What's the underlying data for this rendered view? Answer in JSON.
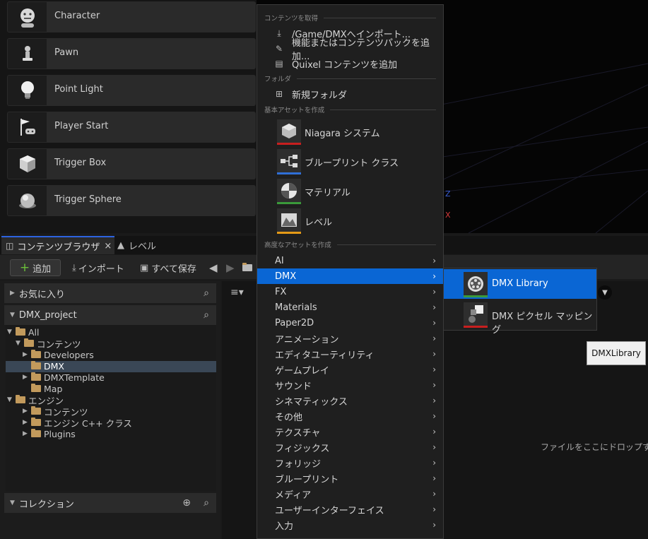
{
  "place_actors": [
    {
      "label": "Character",
      "icon": "character-icon"
    },
    {
      "label": "Pawn",
      "icon": "pawn-icon"
    },
    {
      "label": "Point Light",
      "icon": "light-bulb-icon"
    },
    {
      "label": "Player Start",
      "icon": "player-start-icon"
    },
    {
      "label": "Trigger Box",
      "icon": "trigger-box-icon"
    },
    {
      "label": "Trigger Sphere",
      "icon": "trigger-sphere-icon"
    }
  ],
  "viewport": {
    "axis_z": "Z",
    "axis_x": "X"
  },
  "tabs": {
    "content_browser": "コンテンツブラウザ",
    "close": "×",
    "level": "レベル"
  },
  "toolbar": {
    "add": "追加",
    "import": "インポート",
    "save_all": "すべて保存"
  },
  "left_panel": {
    "favorites": "お気に入り",
    "project": "DMX_project",
    "collections": "コレクション"
  },
  "tree": [
    {
      "label": "All"
    },
    {
      "label": "コンテンツ"
    },
    {
      "label": "Developers"
    },
    {
      "label": "DMX"
    },
    {
      "label": "DMXTemplate"
    },
    {
      "label": "Map"
    },
    {
      "label": "エンジン"
    },
    {
      "label": "コンテンツ"
    },
    {
      "label": "エンジン C++ クラス"
    },
    {
      "label": "Plugins"
    }
  ],
  "content": {
    "drop_hint": "ファイルをここにドロップす"
  },
  "menu": {
    "header_get": "コンテンツを取得",
    "import_to": "/Game/DMXへインポート...",
    "add_feature": "機能またはコンテンツパックを追加...",
    "quixel": "Quixel コンテンツを追加",
    "header_folder": "フォルダ",
    "new_folder": "新規フォルダ",
    "header_basic": "基本アセットを作成",
    "basic_assets": [
      {
        "label": "Niagara システム",
        "color": "#c81f1f"
      },
      {
        "label": "ブループリント クラス",
        "color": "#2f6fd6"
      },
      {
        "label": "マテリアル",
        "color": "#3a9a3a"
      },
      {
        "label": "レベル",
        "color": "#e59a17"
      }
    ],
    "header_advanced": "高度なアセットを作成",
    "advanced": [
      "AI",
      "DMX",
      "FX",
      "Materials",
      "Paper2D",
      "アニメーション",
      "エディタユーティリティ",
      "ゲームプレイ",
      "サウンド",
      "シネマティックス",
      "その他",
      "テクスチャ",
      "フィジックス",
      "フォリッジ",
      "ブループリント",
      "メディア",
      "ユーザーインターフェイス",
      "入力"
    ],
    "active_item": "DMX"
  },
  "submenu": [
    {
      "label": "DMX Library",
      "color": "#3a9a3a"
    },
    {
      "label": "DMX ピクセル マッピング",
      "color": "#c81f1f"
    }
  ],
  "tooltip": "DMXLibrary"
}
